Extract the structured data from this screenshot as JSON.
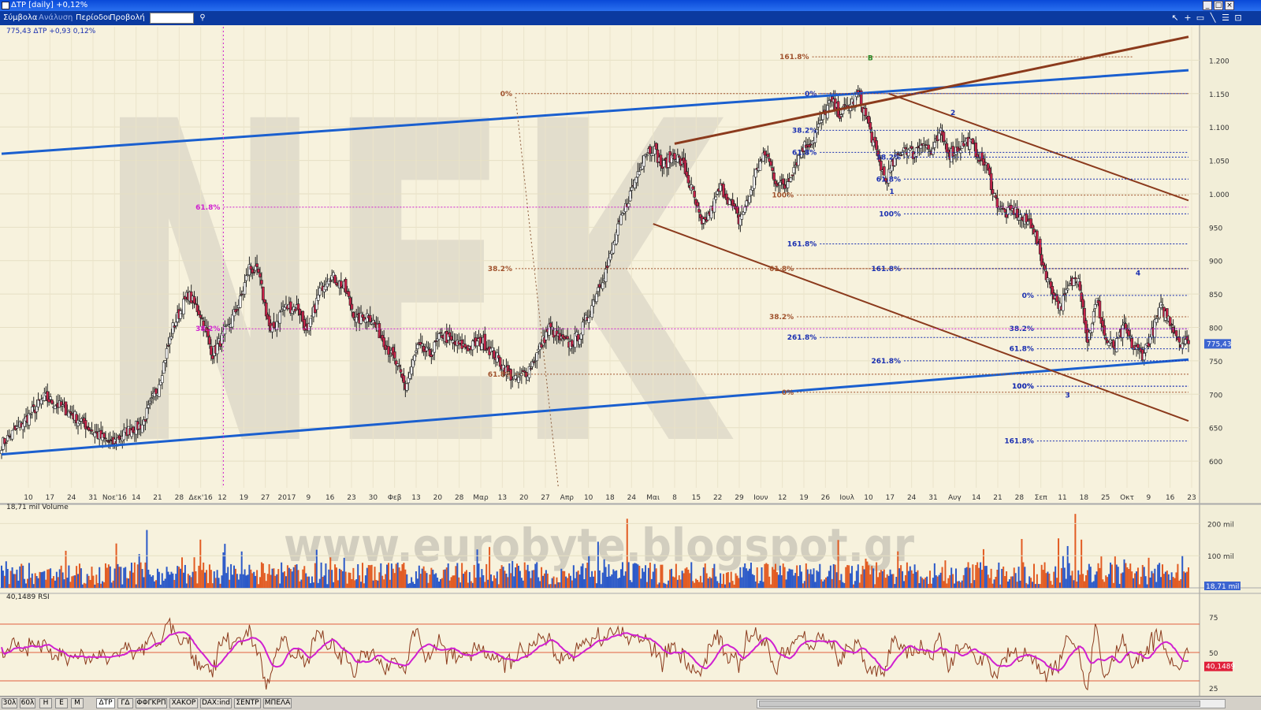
{
  "window": {
    "title": "ΔΤΡ [daily] +0,12%"
  },
  "menu": {
    "items": [
      "Σύμβολα",
      "Ανάλυση",
      "Περίοδοι",
      "Προβολή"
    ]
  },
  "watermark": {
    "letters": "NEK",
    "url": "www.eurobyte.blogspot.gr"
  },
  "bottom_tabs": {
    "periods": [
      "30λ",
      "60λ",
      "H",
      "E",
      "M"
    ],
    "symbols": [
      "ΔΤΡ",
      "ΓΔ",
      "ΦΦΓΚΡΠ",
      "ΧΑΚΟΡ",
      "DAX:ind",
      "ΣΕΝΤΡ",
      "ΜΠΕΛΑ"
    ],
    "active_symbol": "ΔΤΡ"
  },
  "chart_data": [
    {
      "type": "candlestick",
      "panel": "price",
      "legend": "775,43 ΔΤΡ +0,93 0,12%",
      "last_price": 775.43,
      "last_label": "775,43",
      "ylim": [
        560,
        1250
      ],
      "y_ticks": [
        600,
        650,
        700,
        750,
        800,
        850,
        900,
        950,
        1000,
        1050,
        1100,
        1150,
        1200
      ],
      "y_tick_labels": [
        "600",
        "650",
        "700",
        "750",
        "800",
        "850",
        "900",
        "950",
        "1.000",
        "1.050",
        "1.100",
        "1.150",
        "1.200"
      ],
      "x_tick_labels": [
        "10",
        "17",
        "24",
        "31",
        "Νοε'16",
        "14",
        "21",
        "28",
        "Δεκ'16",
        "12",
        "19",
        "27",
        "2017",
        "9",
        "16",
        "23",
        "30",
        "Φεβ",
        "13",
        "20",
        "28",
        "Μαρ",
        "13",
        "20",
        "27",
        "Απρ",
        "10",
        "18",
        "24",
        "Μαι",
        "8",
        "15",
        "22",
        "29",
        "Ιουν",
        "12",
        "19",
        "26",
        "Ιουλ",
        "10",
        "17",
        "24",
        "31",
        "Αυγ",
        "14",
        "21",
        "28",
        "Σεπ",
        "11",
        "18",
        "25",
        "Οκτ",
        "9",
        "16",
        "23"
      ],
      "close_path": [
        [
          0,
          625
        ],
        [
          15,
          660
        ],
        [
          28,
          695
        ],
        [
          40,
          680
        ],
        [
          52,
          660
        ],
        [
          62,
          640
        ],
        [
          72,
          625
        ],
        [
          82,
          645
        ],
        [
          92,
          655
        ],
        [
          102,
          710
        ],
        [
          112,
          800
        ],
        [
          122,
          850
        ],
        [
          130,
          820
        ],
        [
          138,
          760
        ],
        [
          148,
          800
        ],
        [
          156,
          840
        ],
        [
          162,
          890
        ],
        [
          168,
          880
        ],
        [
          176,
          790
        ],
        [
          184,
          830
        ],
        [
          194,
          830
        ],
        [
          200,
          790
        ],
        [
          208,
          855
        ],
        [
          214,
          880
        ],
        [
          224,
          860
        ],
        [
          232,
          810
        ],
        [
          240,
          820
        ],
        [
          250,
          780
        ],
        [
          258,
          745
        ],
        [
          264,
          710
        ],
        [
          272,
          770
        ],
        [
          280,
          760
        ],
        [
          288,
          790
        ],
        [
          296,
          775
        ],
        [
          306,
          770
        ],
        [
          314,
          780
        ],
        [
          322,
          760
        ],
        [
          330,
          735
        ],
        [
          336,
          720
        ],
        [
          344,
          735
        ],
        [
          350,
          760
        ],
        [
          358,
          800
        ],
        [
          366,
          780
        ],
        [
          372,
          775
        ],
        [
          378,
          790
        ],
        [
          384,
          820
        ],
        [
          390,
          860
        ],
        [
          396,
          890
        ],
        [
          402,
          940
        ],
        [
          408,
          980
        ],
        [
          414,
          1020
        ],
        [
          420,
          1060
        ],
        [
          426,
          1070
        ],
        [
          432,
          1040
        ],
        [
          440,
          1060
        ],
        [
          446,
          1040
        ],
        [
          452,
          1000
        ],
        [
          458,
          950
        ],
        [
          464,
          975
        ],
        [
          470,
          1010
        ],
        [
          476,
          990
        ],
        [
          482,
          960
        ],
        [
          488,
          990
        ],
        [
          494,
          1040
        ],
        [
          500,
          1060
        ],
        [
          506,
          1020
        ],
        [
          512,
          1010
        ],
        [
          518,
          1040
        ],
        [
          524,
          1070
        ],
        [
          530,
          1080
        ],
        [
          536,
          1110
        ],
        [
          542,
          1140
        ],
        [
          548,
          1120
        ],
        [
          554,
          1130
        ],
        [
          560,
          1150
        ],
        [
          566,
          1110
        ],
        [
          572,
          1060
        ],
        [
          578,
          1020
        ],
        [
          584,
          1050
        ],
        [
          590,
          1070
        ],
        [
          596,
          1060
        ],
        [
          602,
          1080
        ],
        [
          608,
          1060
        ],
        [
          614,
          1090
        ],
        [
          620,
          1060
        ],
        [
          626,
          1070
        ],
        [
          632,
          1080
        ],
        [
          638,
          1060
        ],
        [
          644,
          1040
        ],
        [
          650,
          990
        ],
        [
          656,
          970
        ],
        [
          662,
          975
        ],
        [
          668,
          960
        ],
        [
          674,
          955
        ],
        [
          680,
          900
        ],
        [
          686,
          860
        ],
        [
          692,
          830
        ],
        [
          698,
          860
        ],
        [
          704,
          880
        ],
        [
          710,
          780
        ],
        [
          716,
          840
        ],
        [
          722,
          780
        ],
        [
          728,
          770
        ],
        [
          734,
          800
        ],
        [
          740,
          770
        ],
        [
          746,
          760
        ],
        [
          752,
          790
        ],
        [
          758,
          830
        ],
        [
          764,
          810
        ],
        [
          770,
          780
        ],
        [
          776,
          775
        ]
      ]
    },
    {
      "type": "bar",
      "panel": "volume",
      "legend": "18,71 mil Volume",
      "ylim": [
        0,
        250
      ],
      "y_tick_labels": [
        "100 mil",
        "200 mil"
      ],
      "y_ticks": [
        100,
        200
      ],
      "last_label": "18,71 mil",
      "highlights": [
        {
          "index": 95,
          "value": 180
        },
        {
          "index": 130,
          "value": 150
        },
        {
          "index": 409,
          "value": 215
        },
        {
          "index": 702,
          "value": 230
        },
        {
          "index": 697,
          "value": 130
        },
        {
          "index": 706,
          "value": 150
        }
      ]
    },
    {
      "type": "line",
      "panel": "rsi",
      "legend": "40,1489 RSI",
      "last_label": "40,1489",
      "ylim": [
        20,
        90
      ],
      "y_ticks": [
        25,
        50,
        75
      ],
      "y_tick_labels": [
        "25",
        "50",
        "75"
      ],
      "levels": [
        30,
        50,
        70
      ]
    }
  ],
  "drawings": {
    "fib_labels_brown": [
      "161.8%",
      "0%",
      "38.2%",
      "61.8%",
      "100%",
      "38.2%",
      "0%",
      "61.8%"
    ],
    "fib_labels_blue": [
      "0%",
      "38.2%",
      "61.8%",
      "100%",
      "161.8%",
      "261.8%",
      "38.2%",
      "61.8%",
      "100%",
      "161.8%",
      "261.8%",
      "0%",
      "38.2%",
      "61.8%",
      "100%",
      "161.8%"
    ],
    "fib_labels_pink": [
      "61.8%",
      "38.2%"
    ],
    "wave_labels": [
      "B",
      "1",
      "2",
      "3",
      "4"
    ]
  },
  "colors": {
    "background": "#f7f2dd",
    "up": "#f8f8f8",
    "down": "#c8244a",
    "channel": "#1a5fcf",
    "trend": "#8b3a1c",
    "rsi": "#d020d0",
    "volume_up": "#2b59c8",
    "volume_down": "#e25c23"
  }
}
